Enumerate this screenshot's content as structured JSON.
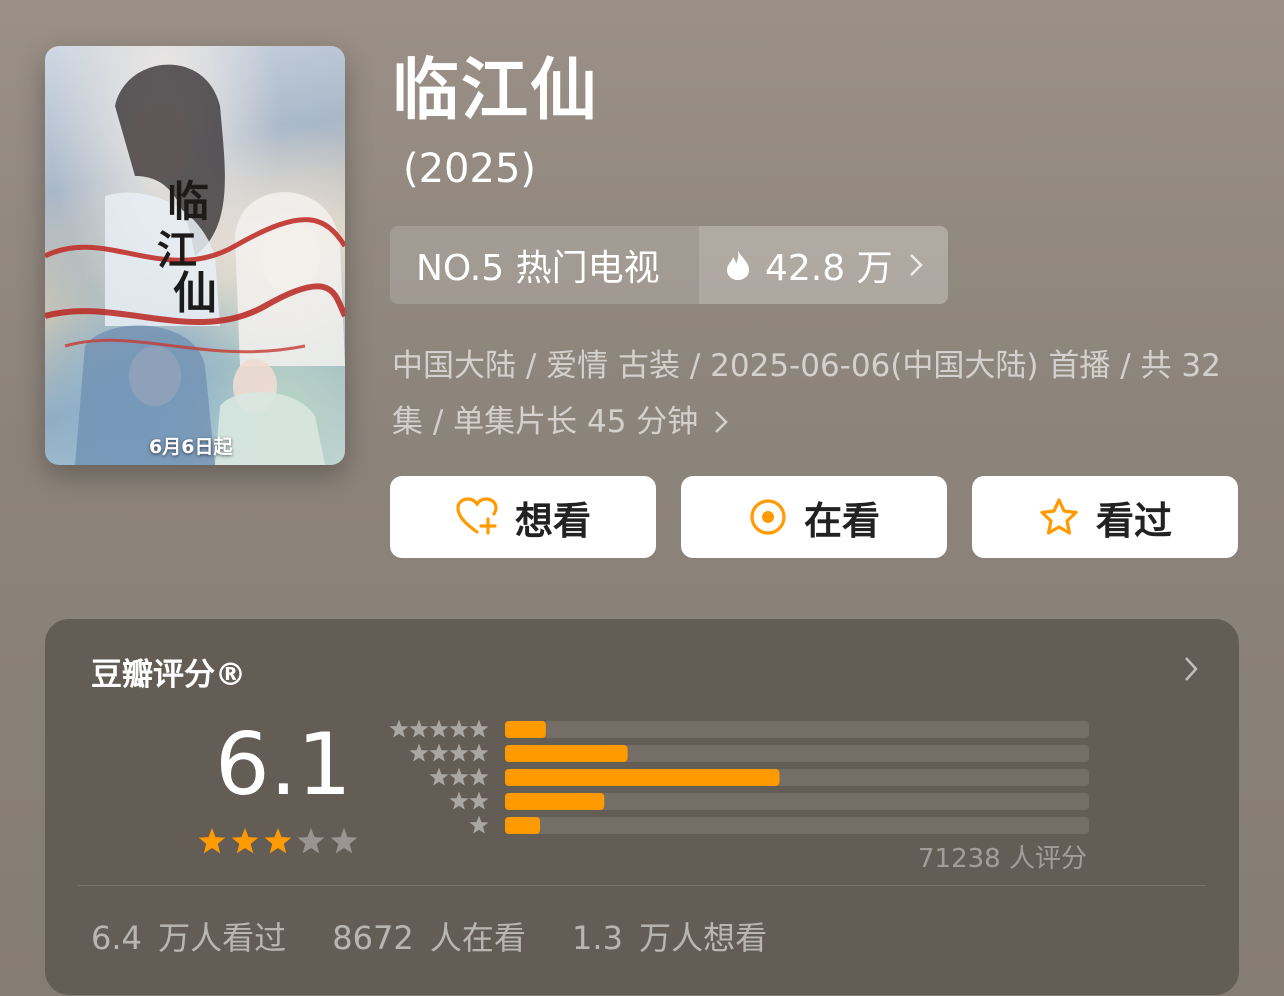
{
  "poster": {
    "text": "6月6日起",
    "colors": {
      "red_ribbon": "#c0302a"
    }
  },
  "header": {
    "title": "临江仙",
    "year": "(2025)"
  },
  "rank": {
    "label": "NO.5 热门电视",
    "heat_icon": "flame-icon",
    "heat": "42.8 万"
  },
  "meta": {
    "info": "中国大陆 / 爱情 古装 / 2025-06-06(中国大陆) 首播 / 共 32 集 / 单集片长 45 分钟"
  },
  "actions": [
    {
      "label": "想看",
      "icon": "heart-plus-icon"
    },
    {
      "label": "在看",
      "icon": "target-circle-icon"
    },
    {
      "label": "看过",
      "icon": "star-outline-icon"
    }
  ],
  "rating": {
    "title": "豆瓣评分®",
    "score": "6.1",
    "stars": 3,
    "distribution": [
      {
        "stars": 5,
        "fraction": 0.07
      },
      {
        "stars": 4,
        "fraction": 0.21
      },
      {
        "stars": 3,
        "fraction": 0.47
      },
      {
        "stars": 2,
        "fraction": 0.17
      },
      {
        "stars": 1,
        "fraction": 0.06
      }
    ],
    "count": "71238 人评分"
  },
  "stats": {
    "watched": "6.4 万人看过",
    "watching": "8672 人在看",
    "want": "1.3 万人想看"
  },
  "colors": {
    "accent": "#ff9a00",
    "card_bg": "#645d56",
    "bar_track": "#756e67"
  }
}
